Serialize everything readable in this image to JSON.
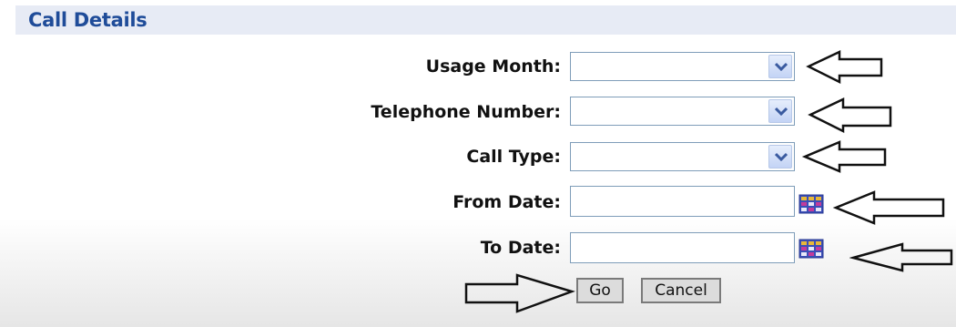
{
  "header": {
    "title": "Call Details"
  },
  "form": {
    "usage_month": {
      "label": "Usage Month:",
      "value": ""
    },
    "telephone_number": {
      "label": "Telephone Number:",
      "value": ""
    },
    "call_type": {
      "label": "Call Type:",
      "value": ""
    },
    "from_date": {
      "label": "From Date:",
      "value": ""
    },
    "to_date": {
      "label": "To Date:",
      "value": ""
    }
  },
  "buttons": {
    "go": "Go",
    "cancel": "Cancel"
  },
  "icons": {
    "dropdown": "chevron-down-icon",
    "calendar": "calendar-icon",
    "annotation_arrow": "arrow-outline-icon"
  },
  "colors": {
    "header_bg": "#e7ebf5",
    "header_text": "#1f4c99",
    "input_border": "#7f9db9",
    "button_bg": "#dcdcdc"
  }
}
